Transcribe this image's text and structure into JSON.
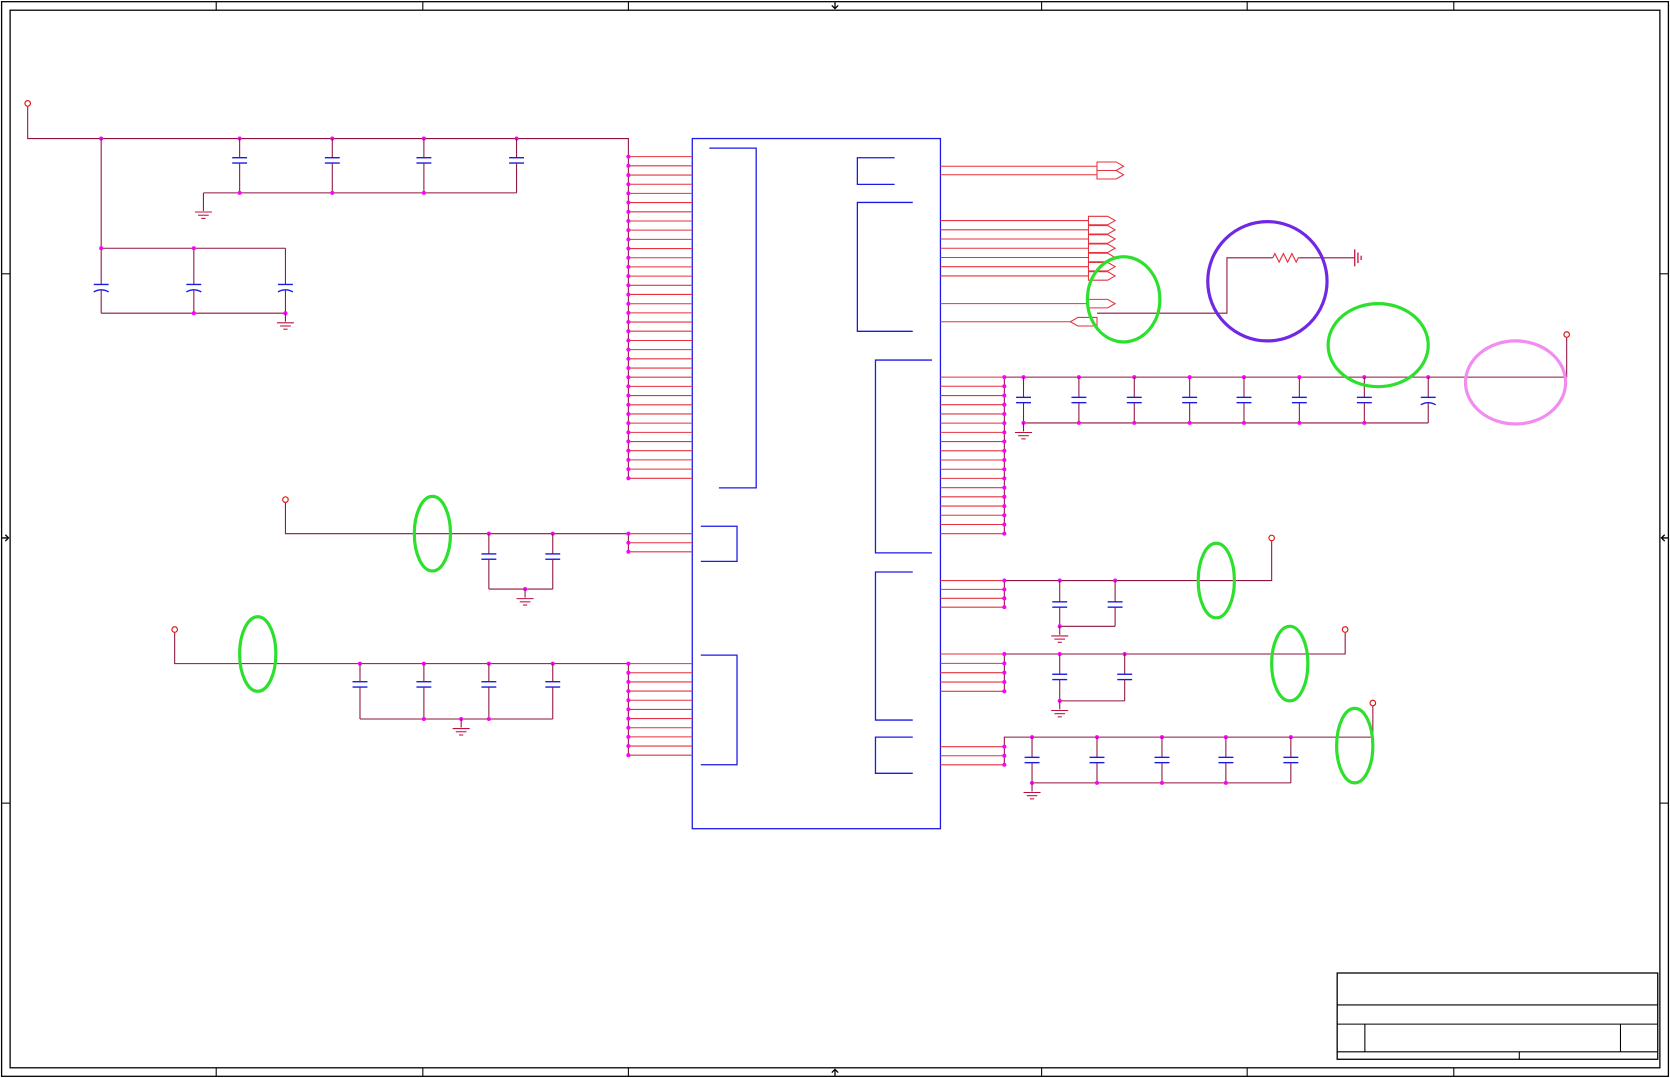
{
  "colors": {
    "background": "#ffffff",
    "frame": "#000000",
    "component": "#1a1ae6",
    "pin_wire": "#e5323e",
    "net_wire": "#8e1240",
    "junction": "#ff00ff",
    "power_port": "#e01818",
    "ground": "#c0103e",
    "highlight_green": "#2ee02e",
    "highlight_purple": "#7028e4",
    "highlight_pink": "#f28cf0"
  },
  "symbols": {
    "power_port": "power-port-icon",
    "ground": "ground-icon",
    "chassis_ground": "chassis-ground-icon",
    "off_page_connector": "off-page-connector-icon",
    "centering_arrow": "centering-arrow-icon"
  }
}
